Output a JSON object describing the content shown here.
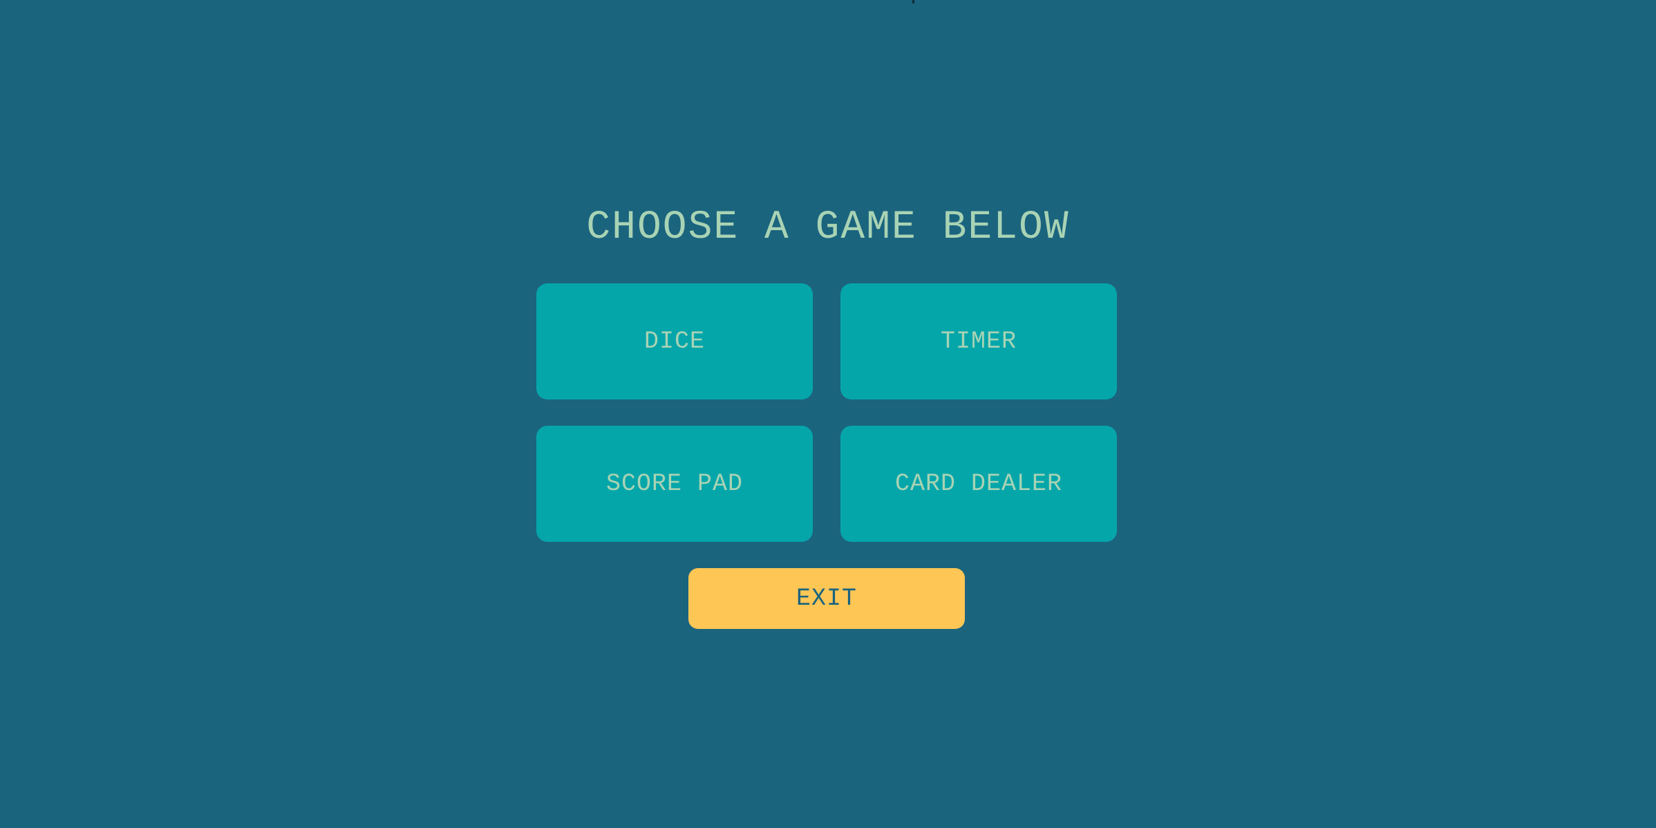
{
  "menu": {
    "title": "CHOOSE A GAME BELOW",
    "games": [
      {
        "label": "DICE"
      },
      {
        "label": "TIMER"
      },
      {
        "label": "SCORE PAD"
      },
      {
        "label": "CARD DEALER"
      }
    ],
    "exit_label": "EXIT"
  },
  "colors": {
    "background": "#1b647e",
    "game_button": "#05a6aa",
    "button_text": "#a8d3b4",
    "exit_button": "#fec655",
    "exit_text": "#1b647e"
  }
}
